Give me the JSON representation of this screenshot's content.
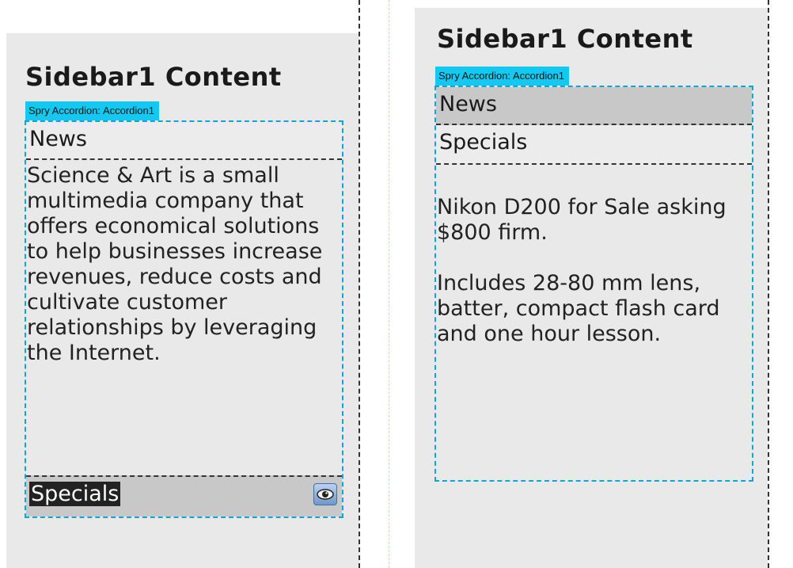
{
  "left_panel": {
    "title": "Sidebar1 Content",
    "spry_label": "Spry Accordion: Accordion1",
    "tabs": [
      {
        "label": "News",
        "state": "open",
        "content": "Science & Art is a small multimedia company that offers economical solutions to help businesses increase revenues, reduce costs and cultivate customer relationships by leveraging the Internet."
      },
      {
        "label": "Specials",
        "state": "closed-selected",
        "icon": "eye-icon"
      }
    ]
  },
  "right_panel": {
    "title": "Sidebar1 Content",
    "spry_label": "Spry Accordion: Accordion1",
    "tabs": [
      {
        "label": "News",
        "state": "closed"
      },
      {
        "label": "Specials",
        "state": "open",
        "content": [
          "Nikon D200 for Sale asking $800 firm.",
          "Includes 28-80 mm lens, batter, compact flash card and one hour lesson."
        ]
      }
    ]
  },
  "colors": {
    "spry_tag": "#16c8ef",
    "accordion_border": "#0ea6d6",
    "panel_bg": "#e9e9e9",
    "active_tab": "#c8c8c8"
  }
}
